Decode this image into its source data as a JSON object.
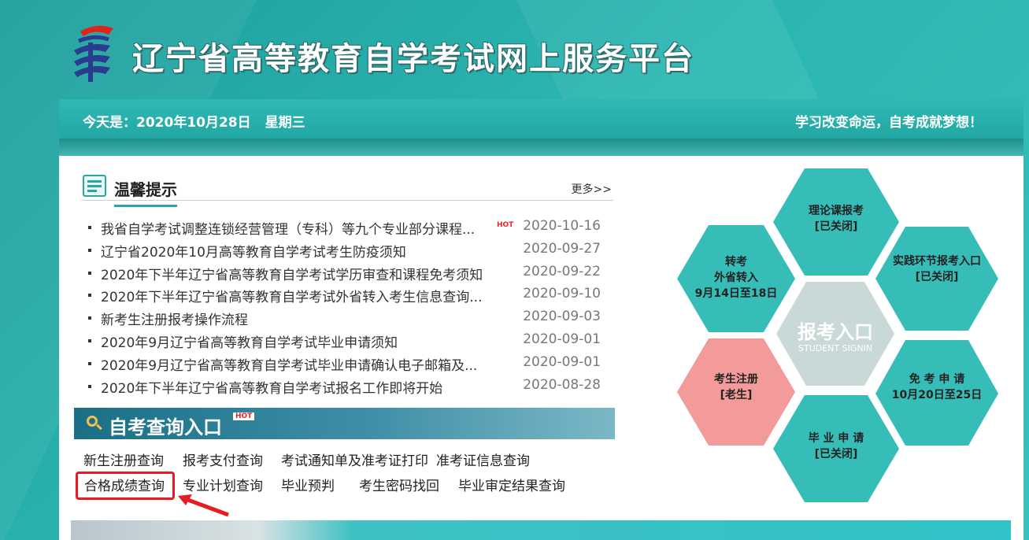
{
  "header": {
    "site_title": "辽宁省高等教育自学考试网上服务平台"
  },
  "datebar": {
    "date_label": "今天是：2020年10月28日",
    "weekday": "星期三",
    "motto": "学习改变命运，自考成就梦想！"
  },
  "notices": {
    "title": "温馨提示",
    "more": "更多>>",
    "hot_badge": "HOT",
    "items": [
      {
        "text": "我省自学考试调整连锁经营管理（专科）等九个专业部分课程...",
        "date": "2020-10-16",
        "hot": true
      },
      {
        "text": "辽宁省2020年10月高等教育自学考试考生防疫须知",
        "date": "2020-09-27",
        "hot": false
      },
      {
        "text": "2020年下半年辽宁省高等教育自学考试学历审查和课程免考须知",
        "date": "2020-09-22",
        "hot": false
      },
      {
        "text": "2020年下半年辽宁省高等教育自学考试外省转入考生信息查询...",
        "date": "2020-09-10",
        "hot": false
      },
      {
        "text": "新考生注册报考操作流程",
        "date": "2020-09-03",
        "hot": false
      },
      {
        "text": "2020年9月辽宁省高等教育自学考试毕业申请须知",
        "date": "2020-09-01",
        "hot": false
      },
      {
        "text": "2020年9月辽宁省高等教育自学考试毕业申请确认电子邮箱及...",
        "date": "2020-09-01",
        "hot": false
      },
      {
        "text": "2020年下半年辽宁省高等教育自学考试报名工作即将开始",
        "date": "2020-08-28",
        "hot": false
      }
    ]
  },
  "query": {
    "title": "自考查询入口",
    "hot_badge": "HOT",
    "links": [
      "新生注册查询",
      "报考支付查询",
      "考试通知单及准考证打印",
      "准考证信息查询",
      "合格成绩查询",
      "专业计划查询",
      "毕业预判",
      "考生密码找回",
      "毕业审定结果查询"
    ]
  },
  "hexes": {
    "center_title": "报考入口",
    "center_sub": "STUDENT SIGNIN",
    "theory": [
      "理论课报考",
      "[已关闭]"
    ],
    "practice": [
      "实践环节报考入口",
      "[已关闭]"
    ],
    "transfer": [
      "转考",
      "外省转入",
      "9月14日至18日"
    ],
    "register": [
      "考生注册",
      "[老生]"
    ],
    "exempt": [
      "免 考 申 请",
      "10月20日至25日"
    ],
    "graduate": [
      "毕 业 申 请",
      "[已关闭]"
    ]
  },
  "colors": {
    "teal": "#36bdb8",
    "pink": "#f39a9a",
    "center_gray": "#c9d9d8",
    "highlight_red": "#e51c23"
  }
}
